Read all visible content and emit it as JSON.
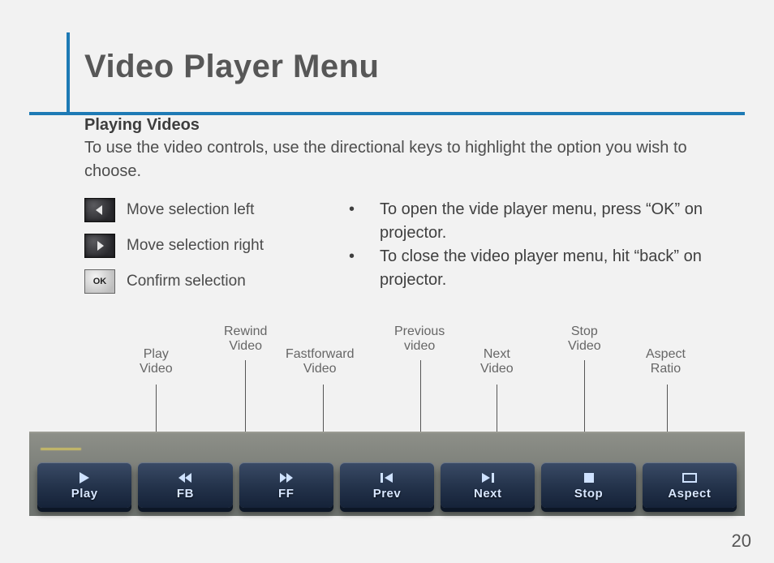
{
  "page": {
    "title": "Video Player Menu",
    "subhead": "Playing Videos",
    "intro": "To use the video controls, use the directional keys to highlight the option you wish to choose.",
    "page_number": "20"
  },
  "legend": {
    "left": "Move selection left",
    "right": "Move selection right",
    "ok": "Confirm selection",
    "ok_glyph": "OK"
  },
  "bullets": {
    "b1": "To open the vide player menu, press “OK” on projector.",
    "b2": "To close the video player menu, hit “back” on projector."
  },
  "callouts": {
    "play": "Play\nVideo",
    "rewind": "Rewind\nVideo",
    "ff": "Fastforward\nVideo",
    "prev": "Previous\nvideo",
    "next": "Next\nVideo",
    "stop": "Stop\nVideo",
    "aspect": "Aspect\nRatio"
  },
  "buttons": {
    "play": "Play",
    "fb": "FB",
    "ff": "FF",
    "prev": "Prev",
    "next": "Next",
    "stop": "Stop",
    "aspect": "Aspect"
  }
}
